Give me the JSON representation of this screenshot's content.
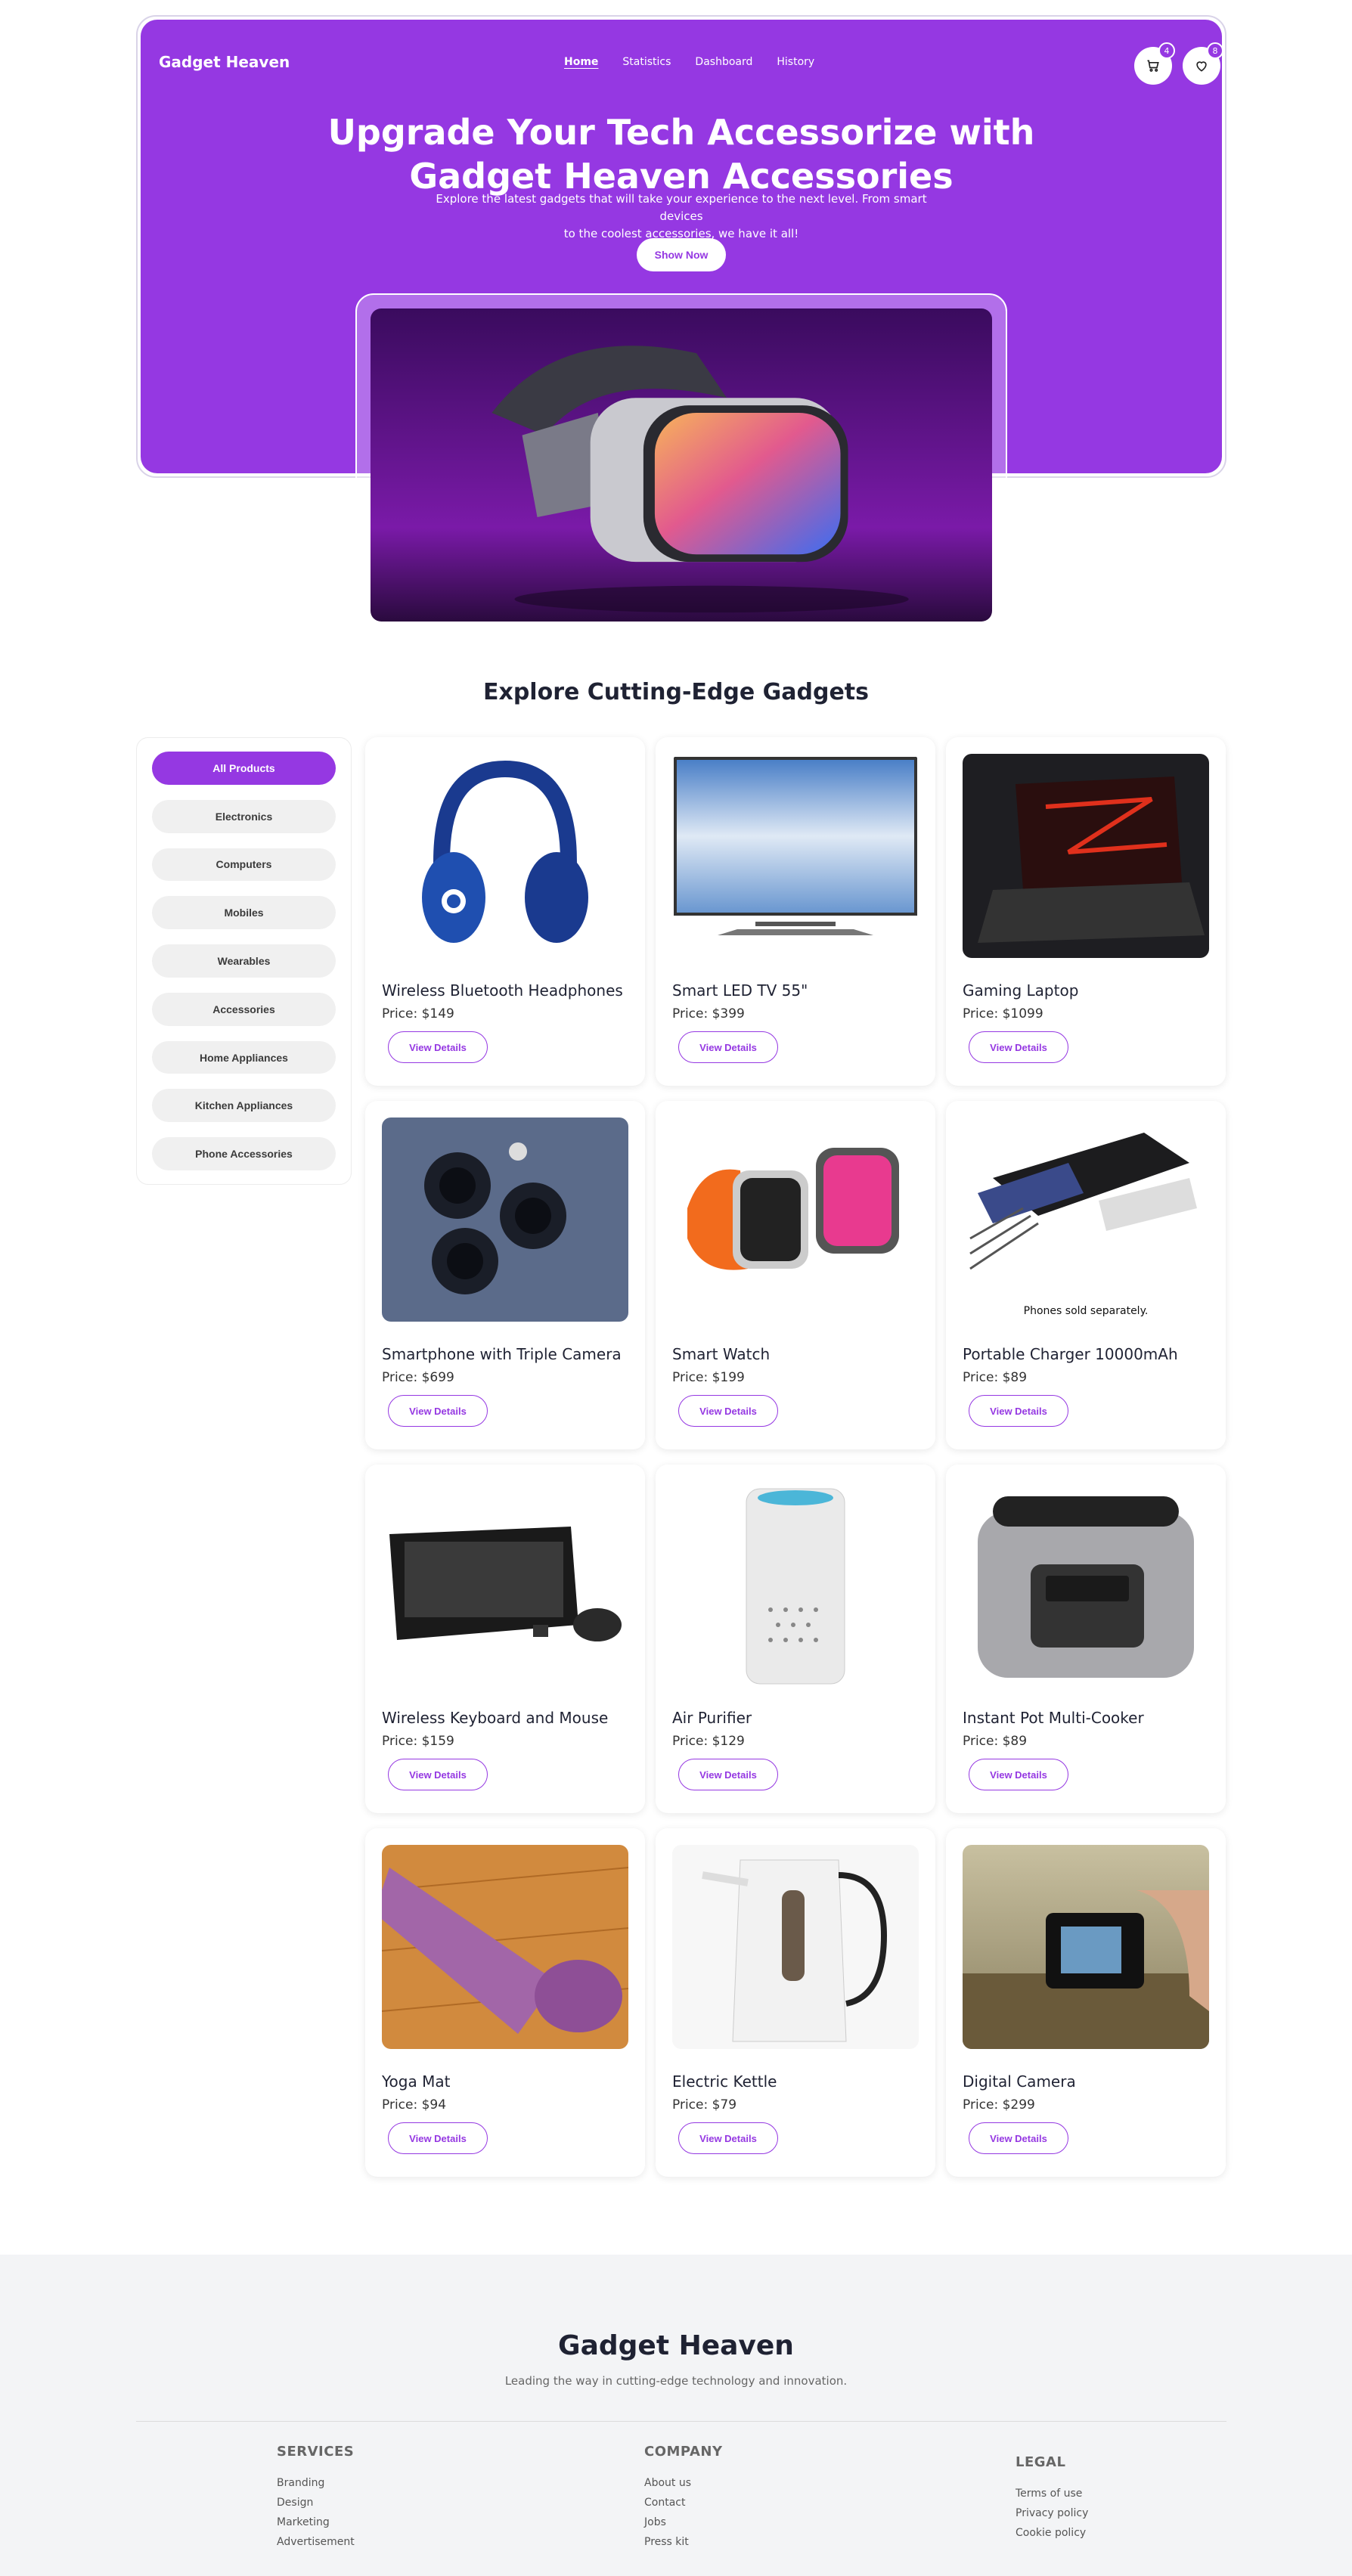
{
  "nav": {
    "logo": "Gadget Heaven",
    "links": [
      "Home",
      "Statistics",
      "Dashboard",
      "History"
    ],
    "cart_count": "4",
    "wishlist_count": "8"
  },
  "hero": {
    "title_line1": "Upgrade Your Tech Accessorize with",
    "title_line2": "Gadget Heaven Accessories",
    "subtitle_line1": "Explore the latest gadgets that will take your experience to the next level. From smart devices",
    "subtitle_line2": "to the coolest accessories, we have it all!",
    "button": "Show Now"
  },
  "section_title": "Explore Cutting-Edge Gadgets",
  "categories": [
    "All Products",
    "Electronics",
    "Computers",
    "Mobiles",
    "Wearables",
    "Accessories",
    "Home Appliances",
    "Kitchen Appliances",
    "Phone Accessories"
  ],
  "products": [
    {
      "name": "Wireless Bluetooth Headphones",
      "price": "Price: $149",
      "button": "View Details"
    },
    {
      "name": "Smart LED TV 55\"",
      "price": "Price: $399",
      "button": "View Details"
    },
    {
      "name": "Gaming Laptop",
      "price": "Price: $1099",
      "button": "View Details"
    },
    {
      "name": "Smartphone with Triple Camera",
      "price": "Price: $699",
      "button": "View Details"
    },
    {
      "name": "Smart Watch",
      "price": "Price: $199",
      "button": "View Details"
    },
    {
      "name": "Portable Charger 10000mAh",
      "price": "Price: $89",
      "button": "View Details"
    },
    {
      "name": "Wireless Keyboard and Mouse",
      "price": "Price: $159",
      "button": "View Details"
    },
    {
      "name": "Air Purifier",
      "price": "Price: $129",
      "button": "View Details"
    },
    {
      "name": "Instant Pot Multi-Cooker",
      "price": "Price: $89",
      "button": "View Details"
    },
    {
      "name": "Yoga Mat",
      "price": "Price: $94",
      "button": "View Details"
    },
    {
      "name": "Electric Kettle",
      "price": "Price: $79",
      "button": "View Details"
    },
    {
      "name": "Digital Camera",
      "price": "Price: $299",
      "button": "View Details"
    }
  ],
  "charger_note": "Phones sold separately.",
  "footer": {
    "title": "Gadget Heaven",
    "subtitle": "Leading the way in cutting-edge technology and innovation.",
    "services": {
      "heading": "SERVICES",
      "links": [
        "Branding",
        "Design",
        "Marketing",
        "Advertisement"
      ]
    },
    "company": {
      "heading": "COMPANY",
      "links": [
        "About us",
        "Contact",
        "Jobs",
        "Press kit"
      ]
    },
    "legal": {
      "heading": "LEGAL",
      "links": [
        "Terms of use",
        "Privacy policy",
        "Cookie policy"
      ]
    }
  },
  "colors": {
    "brand": "#9538e2",
    "footer_bg": "#f3f4f6"
  }
}
